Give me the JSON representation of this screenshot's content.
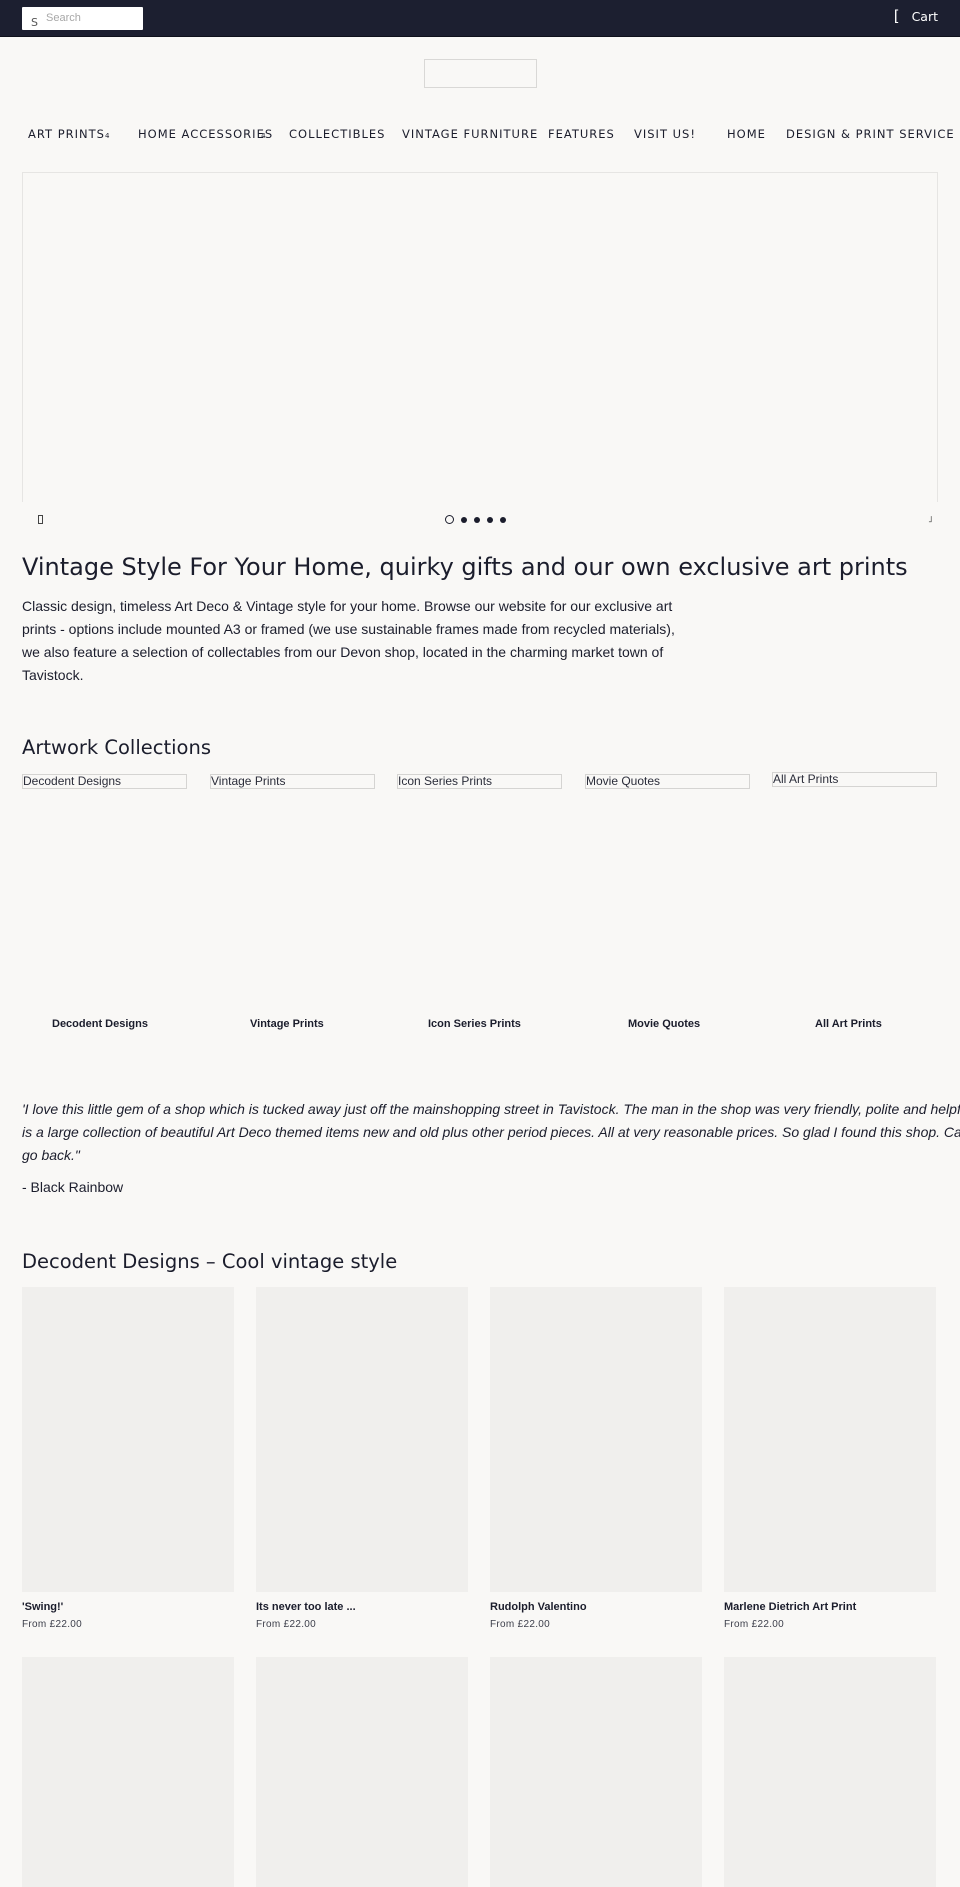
{
  "header": {
    "search": {
      "icon": "S",
      "placeholder": "Search",
      "value": ""
    },
    "cart": {
      "icon": "[",
      "label": "Cart"
    }
  },
  "nav": {
    "items": [
      {
        "label": "ART PRINTS",
        "caret": "4"
      },
      {
        "label": "HOME ACCESSORIES",
        "caret": "4"
      },
      {
        "label": "COLLECTIBLES",
        "caret": ""
      },
      {
        "label": "VINTAGE FURNITURE",
        "caret": ""
      },
      {
        "label": "FEATURES",
        "caret": ""
      },
      {
        "label": "VISIT US!",
        "caret": ""
      },
      {
        "label": "HOME",
        "caret": ""
      },
      {
        "label": "DESIGN & PRINT SERVICE",
        "caret": ""
      }
    ]
  },
  "slideshow": {
    "prev_icon": "",
    "next_icon": "˩",
    "slide_count": 5,
    "active_index": 0
  },
  "intro": {
    "headline": "Vintage Style For Your Home, quirky gifts and our own exclusive art prints",
    "body": "Classic design, timeless Art Deco & Vintage style for your home. Browse our website for our exclusive art prints - options include mounted A3 or framed (we use sustainable frames made from recycled materials), we also feature a selection of collectables from our Devon shop, located in the charming market town of Tavistock."
  },
  "collections": {
    "title": "Artwork Collections",
    "items": [
      {
        "alt": "Decodent Designs",
        "label": "Decodent Designs"
      },
      {
        "alt": "Vintage Prints",
        "label": "Vintage Prints"
      },
      {
        "alt": "Icon Series Prints",
        "label": "Icon Series Prints"
      },
      {
        "alt": "Movie Quotes",
        "label": "Movie Quotes"
      },
      {
        "alt": "All Art Prints",
        "label": "All Art Prints"
      }
    ]
  },
  "testimonial": {
    "quote": "'I love this little gem of a shop which is tucked away just off the mainshopping street in Tavistock. The man in the shop was very friendly, polite and helpful. There is a large collection of beautiful Art Deco themed items new and old plus other period pieces. All at very reasonable prices. So glad I found this shop. Can't wait to go back.\"",
    "author": "- Black Rainbow"
  },
  "featured": {
    "title": "Decodent Designs – Cool vintage style",
    "products": [
      {
        "title": "'Swing!'",
        "price": "From £22.00"
      },
      {
        "title": "Its never too late ...",
        "price": "From £22.00"
      },
      {
        "title": "Rudolph Valentino",
        "price": "From £22.00"
      },
      {
        "title": "Marlene Dietrich Art Print",
        "price": "From £22.00"
      },
      {
        "title": "",
        "price": ""
      },
      {
        "title": "",
        "price": ""
      },
      {
        "title": "",
        "price": ""
      },
      {
        "title": "",
        "price": ""
      }
    ]
  }
}
